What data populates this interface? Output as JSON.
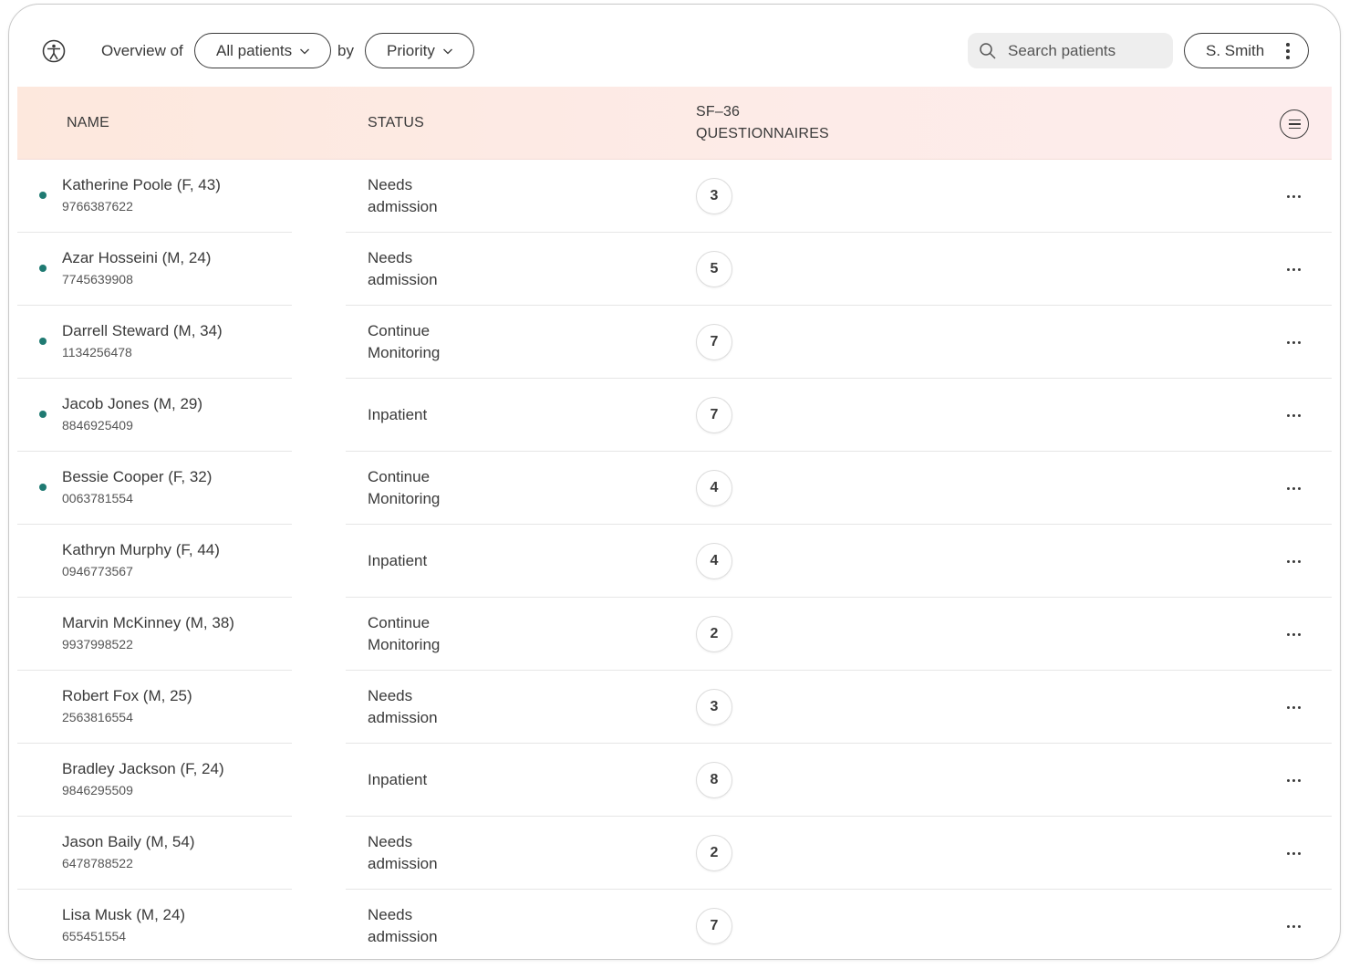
{
  "header": {
    "overview_label": "Overview of",
    "filter_value": "All patients",
    "by_label": "by",
    "sort_value": "Priority",
    "search_placeholder": "Search patients",
    "user_name": "S. Smith"
  },
  "table": {
    "columns": {
      "name": "NAME",
      "status": "STATUS",
      "questionnaires_line1": "SF–36",
      "questionnaires_line2": "QUESTIONNAIRES"
    },
    "rows": [
      {
        "name": "Katherine Poole (F, 43)",
        "id": "9766387622",
        "status": "Needs admission",
        "count": "3",
        "flagged": true
      },
      {
        "name": "Azar Hosseini (M, 24)",
        "id": "7745639908",
        "status": "Needs admission",
        "count": "5",
        "flagged": true
      },
      {
        "name": "Darrell Steward (M, 34)",
        "id": "1134256478",
        "status": "Continue Monitoring",
        "count": "7",
        "flagged": true
      },
      {
        "name": "Jacob Jones (M, 29)",
        "id": "8846925409",
        "status": "Inpatient",
        "count": "7",
        "flagged": true
      },
      {
        "name": "Bessie Cooper (F, 32)",
        "id": "0063781554",
        "status": "Continue Monitoring",
        "count": "4",
        "flagged": true
      },
      {
        "name": "Kathryn Murphy (F, 44)",
        "id": "0946773567",
        "status": "Inpatient",
        "count": "4",
        "flagged": false
      },
      {
        "name": "Marvin McKinney (M, 38)",
        "id": "9937998522",
        "status": "Continue Monitoring",
        "count": "2",
        "flagged": false
      },
      {
        "name": "Robert Fox (M, 25)",
        "id": "2563816554",
        "status": "Needs admission",
        "count": "3",
        "flagged": false
      },
      {
        "name": "Bradley Jackson (F, 24)",
        "id": "9846295509",
        "status": "Inpatient",
        "count": "8",
        "flagged": false
      },
      {
        "name": "Jason Baily (M, 54)",
        "id": "6478788522",
        "status": "Needs admission",
        "count": "2",
        "flagged": false
      },
      {
        "name": "Lisa Musk (M, 24)",
        "id": "655451554",
        "status": "Needs admission",
        "count": "7",
        "flagged": false
      }
    ]
  },
  "icons": {
    "logo": "accessibility-person-icon",
    "filter_chevron": "chevron-down-icon",
    "search": "search-icon",
    "user_menu": "kebab-vertical-icon",
    "column_menu": "hamburger-menu-icon",
    "row_menu": "more-horizontal-icon"
  },
  "colors": {
    "accent_dot": "#1f7a72",
    "header_bg_start": "#fde8dd",
    "header_bg_end": "#fdecec"
  }
}
